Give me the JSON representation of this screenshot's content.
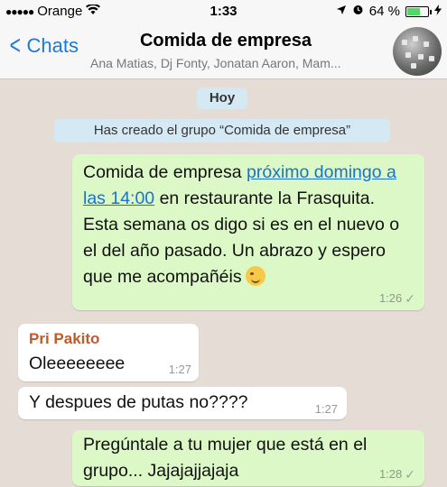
{
  "status": {
    "carrier": "Orange",
    "time": "1:33",
    "battery_percent": "64 %",
    "battery_level": 0.64
  },
  "nav": {
    "back_label": "Chats",
    "title": "Comida de empresa",
    "subtitle": "Ana Matias, Dj Fonty, Jonatan Aaron, Mam..."
  },
  "chat": {
    "date_label": "Hoy",
    "system_message": "Has creado el grupo “Comida de empresa”",
    "messages": [
      {
        "direction": "out",
        "text_before_link": "Comida de empresa ",
        "link_text": "próximo domingo a las 14:00",
        "text_after_link": " en restaurante la Frasquita. Esta semana os digo si es en el nuevo o el del año pasado. Un abrazo y espero que me acompañéis",
        "emoji": "smiling-wink-emoji",
        "time": "1:26",
        "status_icon": "✓"
      },
      {
        "direction": "in",
        "sender": "Pri Pakito",
        "text": "Oleeeeeeee",
        "time": "1:27"
      },
      {
        "direction": "in",
        "text": "Y despues de putas no????",
        "time": "1:27"
      },
      {
        "direction": "out",
        "text": "Pregúntale a tu mujer que está en el grupo... Jajajajjajaja",
        "time": "1:28",
        "status_icon": "✓"
      }
    ]
  },
  "colors": {
    "outgoing_bubble": "#dcf8c6",
    "incoming_bubble": "#ffffff",
    "link": "#1a73c9",
    "sender_name": "#c05a2a",
    "accent": "#1a7bd6"
  }
}
